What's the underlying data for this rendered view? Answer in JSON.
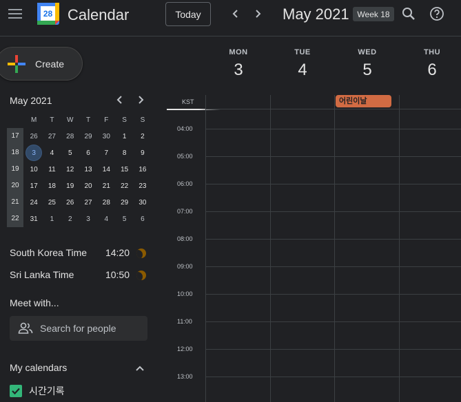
{
  "header": {
    "app_title": "Calendar",
    "logo_day": "28",
    "today_label": "Today",
    "period_title": "May 2021",
    "week_badge": "Week 18"
  },
  "sidebar": {
    "create_label": "Create",
    "mini_calendar": {
      "title": "May 2021",
      "weekday_headers": [
        "M",
        "T",
        "W",
        "T",
        "F",
        "S",
        "S"
      ],
      "weeks": [
        {
          "week": "17",
          "days": [
            "26",
            "27",
            "28",
            "29",
            "30",
            "1",
            "2"
          ]
        },
        {
          "week": "18",
          "days": [
            "3",
            "4",
            "5",
            "6",
            "7",
            "8",
            "9"
          ]
        },
        {
          "week": "19",
          "days": [
            "10",
            "11",
            "12",
            "13",
            "14",
            "15",
            "16"
          ]
        },
        {
          "week": "20",
          "days": [
            "17",
            "18",
            "19",
            "20",
            "21",
            "22",
            "23"
          ]
        },
        {
          "week": "21",
          "days": [
            "24",
            "25",
            "26",
            "27",
            "28",
            "29",
            "30"
          ]
        },
        {
          "week": "22",
          "days": [
            "31",
            "1",
            "2",
            "3",
            "4",
            "5",
            "6"
          ]
        }
      ],
      "today": "3"
    },
    "world_clock": [
      {
        "name": "South Korea Time",
        "time": "14:20"
      },
      {
        "name": "Sri Lanka Time",
        "time": "10:50"
      }
    ],
    "meet_with_title": "Meet with...",
    "search_people_placeholder": "Search for people",
    "my_calendars_title": "My calendars",
    "calendars": [
      {
        "name": "시간기록",
        "color": "#33b679",
        "checked": true
      }
    ]
  },
  "main": {
    "days": [
      {
        "dow": "MON",
        "num": "3"
      },
      {
        "dow": "TUE",
        "num": "4"
      },
      {
        "dow": "WED",
        "num": "5"
      },
      {
        "dow": "THU",
        "num": "6"
      }
    ],
    "timezone_label": "KST",
    "hours": [
      "04:00",
      "05:00",
      "06:00",
      "07:00",
      "08:00",
      "09:00",
      "10:00",
      "11:00",
      "12:00",
      "13:00"
    ],
    "all_day_events": [
      {
        "title": "어린이날",
        "day": "WED",
        "color": "#d16b43"
      }
    ]
  },
  "colors": {
    "background": "#202124",
    "border": "#3c4043",
    "today_highlight": "#8ab4f8",
    "event": "#d16b43"
  }
}
